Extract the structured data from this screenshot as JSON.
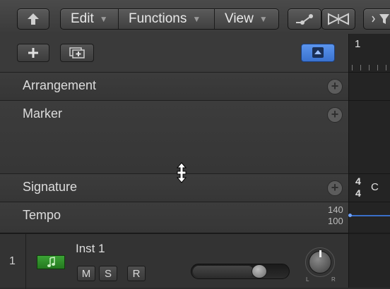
{
  "toolbar": {
    "back_icon": "up-arrow-icon",
    "menus": [
      {
        "label": "Edit"
      },
      {
        "label": "Functions"
      },
      {
        "label": "View"
      }
    ],
    "automation_icon": "automation-curve-icon",
    "flex_icon": "flex-bowtie-icon",
    "filter_icon": "filter-icon"
  },
  "header": {
    "add_icon": "plus-icon",
    "add_folder_icon": "add-track-stack-icon",
    "toggle_icon": "eject-triangle-icon",
    "accent": "#4a86e8"
  },
  "global_tracks": [
    {
      "label": "Arrangement"
    },
    {
      "label": "Marker"
    },
    {
      "label": "Signature"
    },
    {
      "label": "Tempo",
      "range_top": "140",
      "range_bottom": "100"
    }
  ],
  "ruler": {
    "bar": "1",
    "signature_top": "4",
    "signature_bottom": "4",
    "key": "C"
  },
  "track": {
    "number": "1",
    "name": "Inst 1",
    "mute": "M",
    "solo": "S",
    "record": "R",
    "icon": "music-note-icon",
    "pan_left": "L",
    "pan_right": "R",
    "icon_color": "#2f8a2a"
  }
}
